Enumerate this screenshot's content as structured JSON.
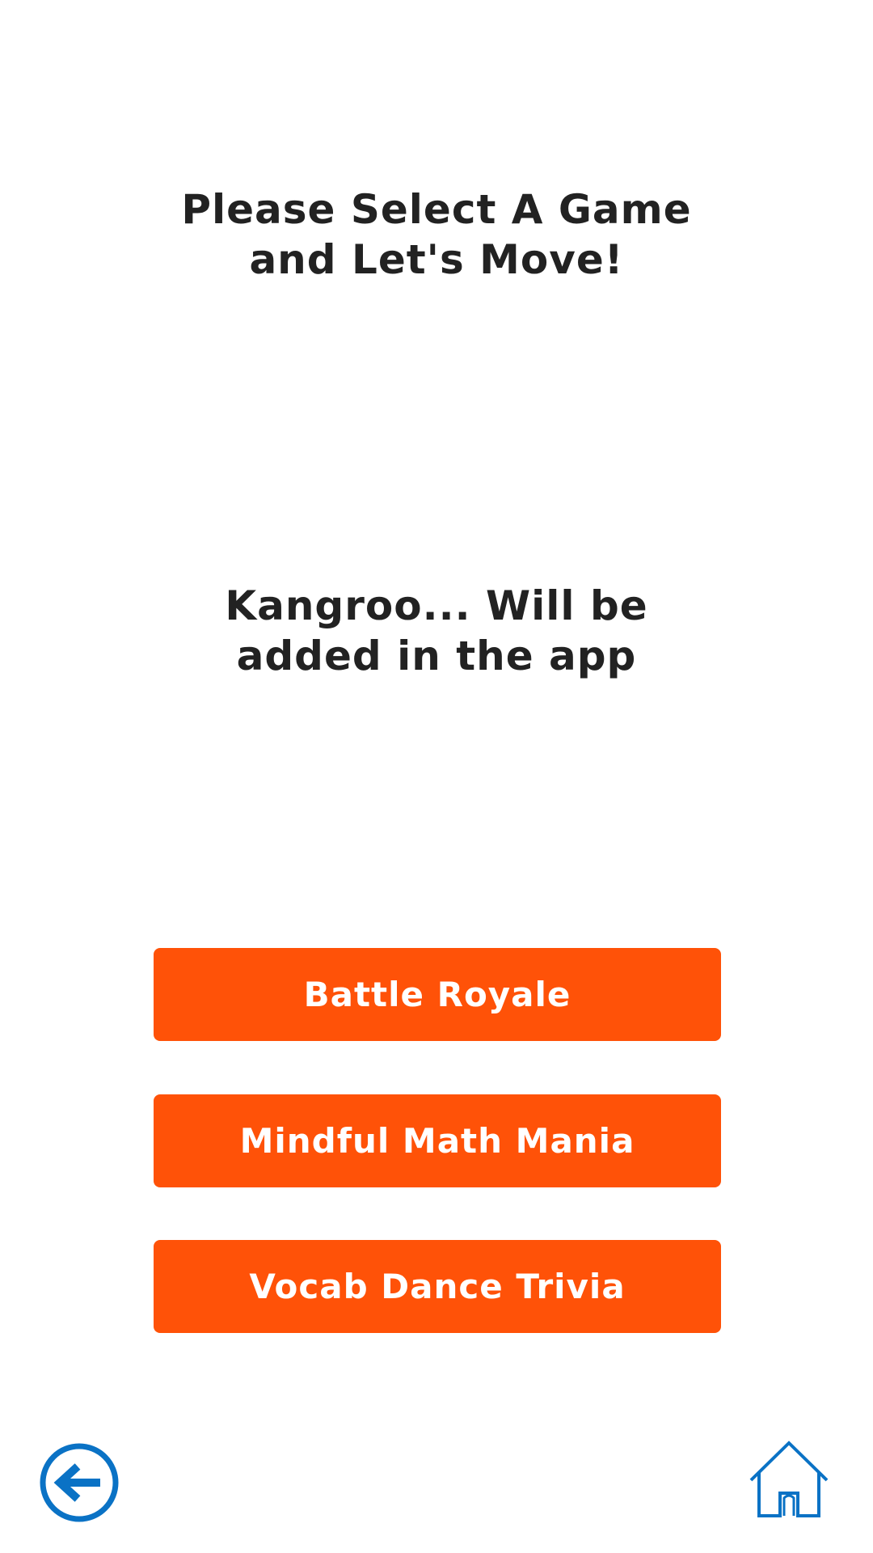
{
  "header": {
    "title_line1": "Please Select A Game",
    "title_line2": "and Let's Move!"
  },
  "notice": {
    "line1": "Kangroo... Will be",
    "line2": "added in the app"
  },
  "games": [
    {
      "label": "Battle Royale"
    },
    {
      "label": "Mindful Math Mania"
    },
    {
      "label": "Vocab Dance Trivia"
    }
  ],
  "footer": {
    "back_icon": "back-arrow-icon",
    "home_icon": "home-icon"
  },
  "colors": {
    "button_bg": "#FF5208",
    "button_text": "#FFFFFF",
    "icon_blue": "#0A72C5",
    "text": "#222222"
  }
}
